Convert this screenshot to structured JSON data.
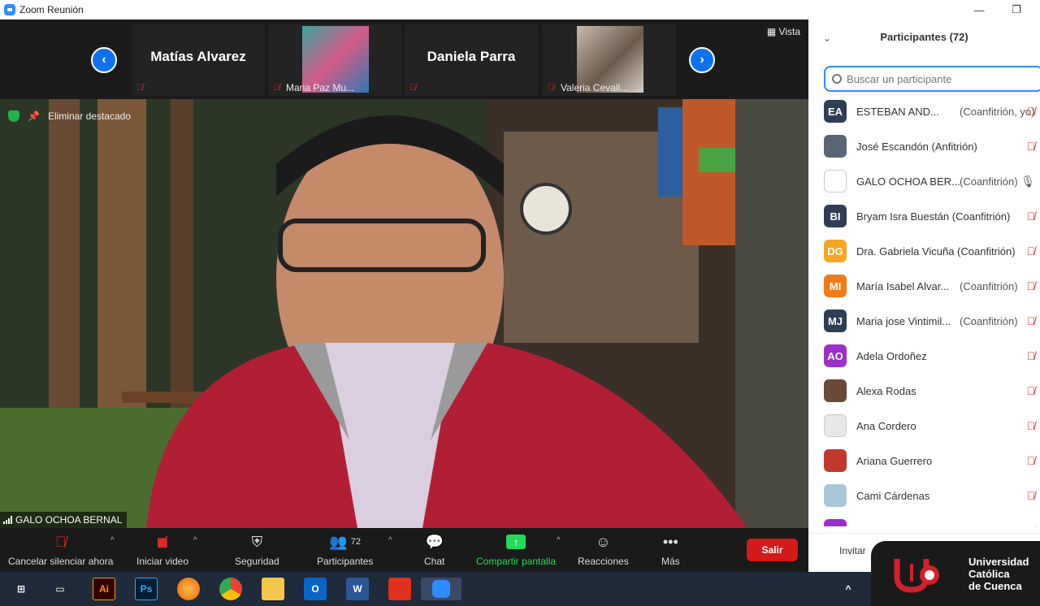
{
  "window": {
    "title": "Zoom Reunión",
    "minimize": "—",
    "restore": "❐"
  },
  "strip": {
    "tiles": [
      {
        "name": "Matías Alvarez",
        "label": ""
      },
      {
        "name": "",
        "label": "Maria Paz Mu..."
      },
      {
        "name": "Daniela Parra",
        "label": ""
      },
      {
        "name": "",
        "label": "Valeria Cevall..."
      }
    ],
    "prev": "‹",
    "next": "›",
    "vista": "Vista"
  },
  "main": {
    "unpin_label": "Eliminar destacado",
    "speaker_name": "GALO OCHOA BERNAL"
  },
  "toolbar": {
    "mute": "Cancelar silenciar ahora",
    "video": "Iniciar video",
    "security": "Seguridad",
    "participants": "Participantes",
    "participants_count": "72",
    "chat": "Chat",
    "share": "Compartir pantalla",
    "reactions": "Reacciones",
    "more": "Más",
    "leave": "Salir"
  },
  "panel": {
    "title": "Participantes (72)",
    "search_placeholder": "Buscar un participante",
    "invite": "Invitar",
    "participants": [
      {
        "initials": "EA",
        "color": "#2f3e55",
        "name": "ESTEBAN AND...",
        "role": "(Coanfitrión, yo)",
        "mic": "muted"
      },
      {
        "initials": "",
        "color": "#5a6675",
        "name": "José Escandón (Anfitrión)",
        "role": "",
        "mic": "muted"
      },
      {
        "initials": "",
        "color": "#ffffff",
        "name": "GALO OCHOA BER...",
        "role": "(Coanfitrión)",
        "mic": "on"
      },
      {
        "initials": "BI",
        "color": "#2f3e55",
        "name": "Bryam Isra Buestán (Coanfitrión)",
        "role": "",
        "mic": "muted"
      },
      {
        "initials": "DG",
        "color": "#f5a623",
        "name": "Dra. Gabriela Vicuña (Coanfitrión)",
        "role": "",
        "mic": "muted"
      },
      {
        "initials": "MI",
        "color": "#f07b17",
        "name": "María Isabel Alvar...",
        "role": "(Coanfitrión)",
        "mic": "muted"
      },
      {
        "initials": "MJ",
        "color": "#2f3e55",
        "name": "Maria jose Vintimil...",
        "role": "(Coanfitrión)",
        "mic": "muted"
      },
      {
        "initials": "AO",
        "color": "#9b30c9",
        "name": "Adela Ordoñez",
        "role": "",
        "mic": "muted"
      },
      {
        "initials": "",
        "color": "#6b4a3a",
        "name": "Alexa Rodas",
        "role": "",
        "mic": "muted"
      },
      {
        "initials": "",
        "color": "#e8e8e8",
        "name": "Ana Cordero",
        "role": "",
        "mic": "muted"
      },
      {
        "initials": "",
        "color": "#c0392b",
        "name": "Ariana Guerrero",
        "role": "",
        "mic": "muted"
      },
      {
        "initials": "",
        "color": "#a8c7d8",
        "name": "Cami Cárdenas",
        "role": "",
        "mic": "muted"
      },
      {
        "initials": "",
        "color": "#9b30c9",
        "name": "",
        "role": "",
        "mic": "muted"
      }
    ]
  },
  "taskbar": {
    "apps": [
      "Ai",
      "Ps",
      "Ps-firefox",
      "chrome",
      "explorer",
      "Ol",
      "W",
      "pdf",
      "zoom"
    ]
  },
  "brand": {
    "line1": "Universidad",
    "line2": "Católica",
    "line3": "de Cuenca"
  }
}
